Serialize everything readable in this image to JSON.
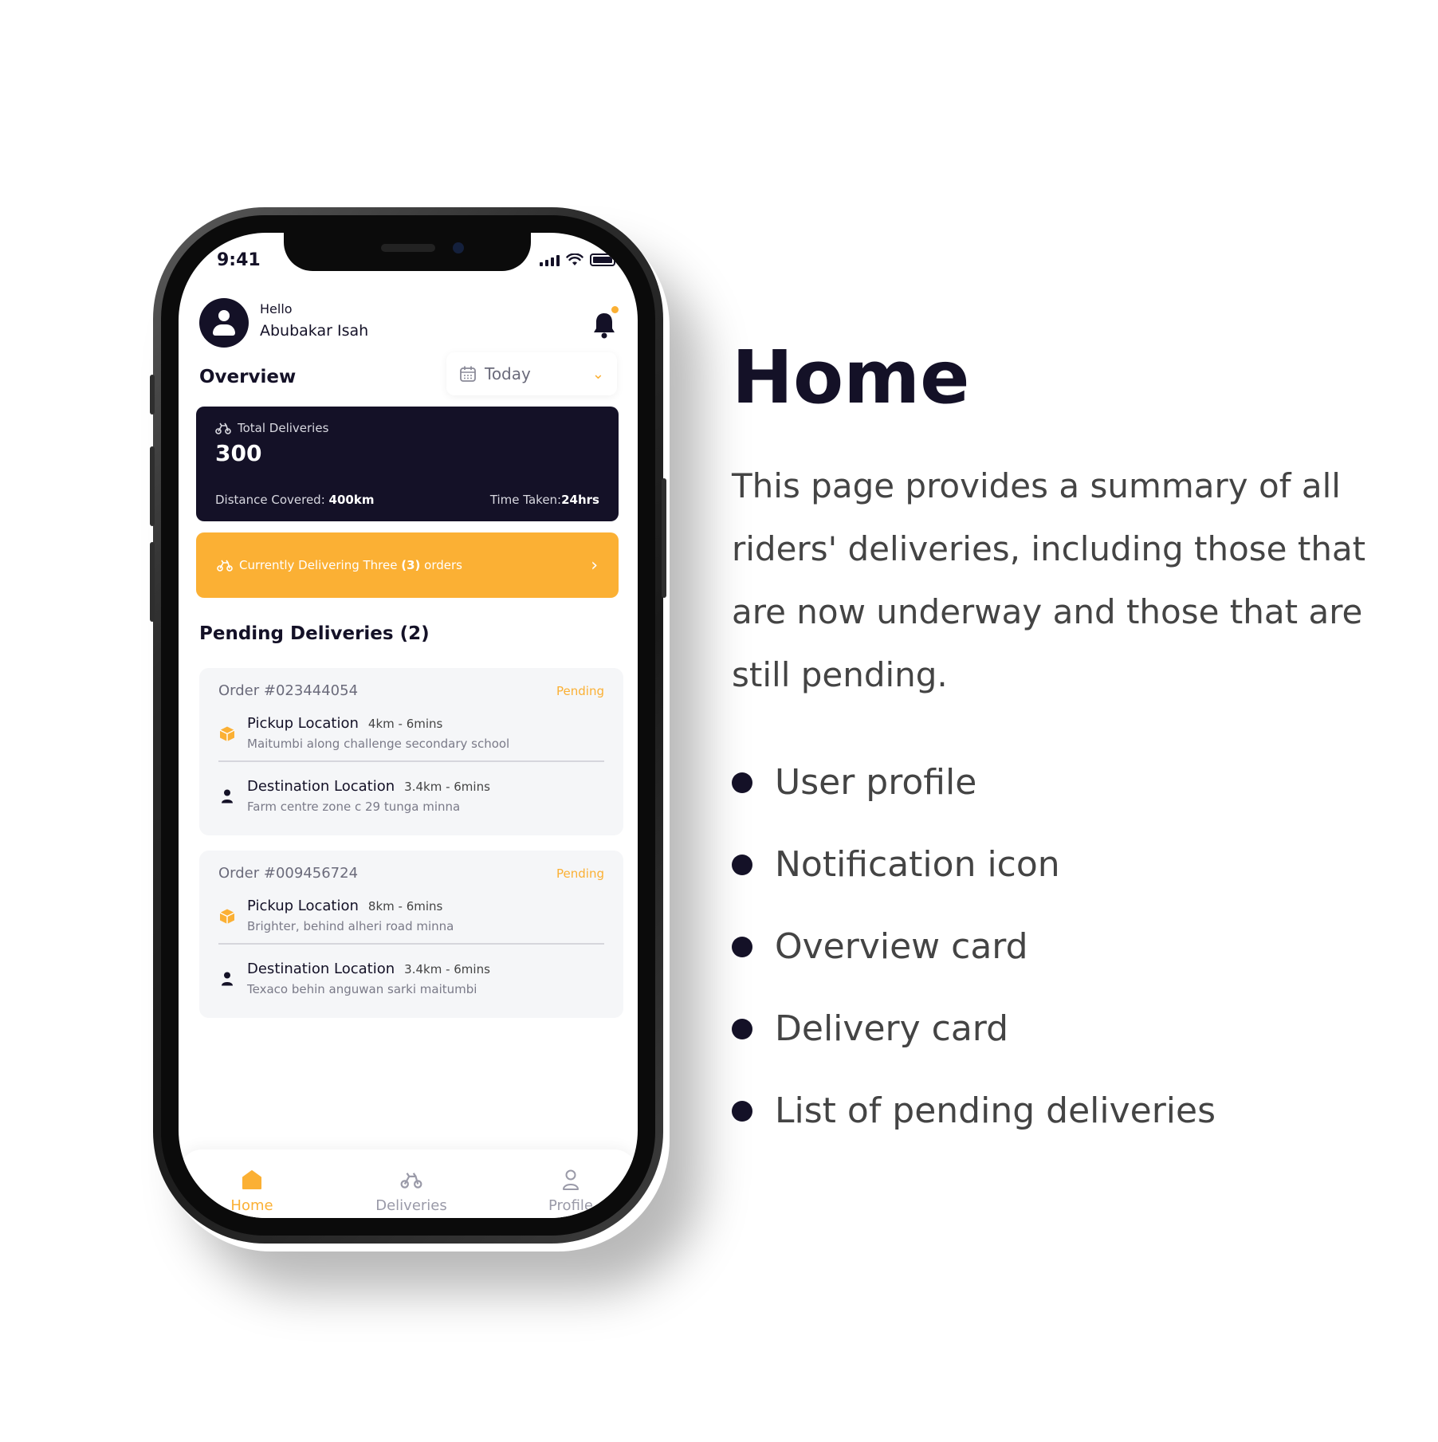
{
  "status_bar": {
    "time": "9:41"
  },
  "header": {
    "greeting": "Hello",
    "user_name": "Abubakar Isah"
  },
  "overview": {
    "title": "Overview",
    "date_filter": "Today",
    "total_label": "Total Deliveries",
    "total_value": "300",
    "distance_label": "Distance Covered:",
    "distance_value": "400km",
    "time_label": "Time Taken:",
    "time_value": "24hrs"
  },
  "current_banner": {
    "text_prefix": "Currently Delivering Three ",
    "text_count": "(3)",
    "text_suffix": " orders"
  },
  "pending": {
    "title": "Pending Deliveries (2)",
    "orders": [
      {
        "order_no": "Order #023444054",
        "status": "Pending",
        "pickup_title": "Pickup Location",
        "pickup_meta": "4km - 6mins",
        "pickup_address": "Maitumbi along challenge secondary school",
        "dest_title": "Destination Location",
        "dest_meta": "3.4km - 6mins",
        "dest_address": "Farm centre zone c 29 tunga minna"
      },
      {
        "order_no": "Order #009456724",
        "status": "Pending",
        "pickup_title": "Pickup Location",
        "pickup_meta": "8km - 6mins",
        "pickup_address": "Brighter, behind alheri road minna",
        "dest_title": "Destination Location",
        "dest_meta": "3.4km - 6mins",
        "dest_address": "Texaco behin anguwan sarki maitumbi"
      }
    ]
  },
  "bottom_nav": {
    "home": "Home",
    "deliveries": "Deliveries",
    "profile": "Profile"
  },
  "description": {
    "heading": "Home",
    "body": "This page provides a summary of all riders' deliveries, including those that are now underway and those that are still pending.",
    "features": [
      "User profile",
      "Notification icon",
      "Overview card",
      "Delivery card",
      "List of pending deliveries"
    ]
  },
  "colors": {
    "accent": "#FBB034",
    "dark": "#141127",
    "card_bg": "#F5F6F8"
  },
  "icons": [
    "avatar-icon",
    "bell-icon",
    "calendar-icon",
    "chevron-down-icon",
    "bike-icon",
    "chevron-right-icon",
    "box-icon",
    "person-icon",
    "home-icon",
    "user-icon"
  ]
}
